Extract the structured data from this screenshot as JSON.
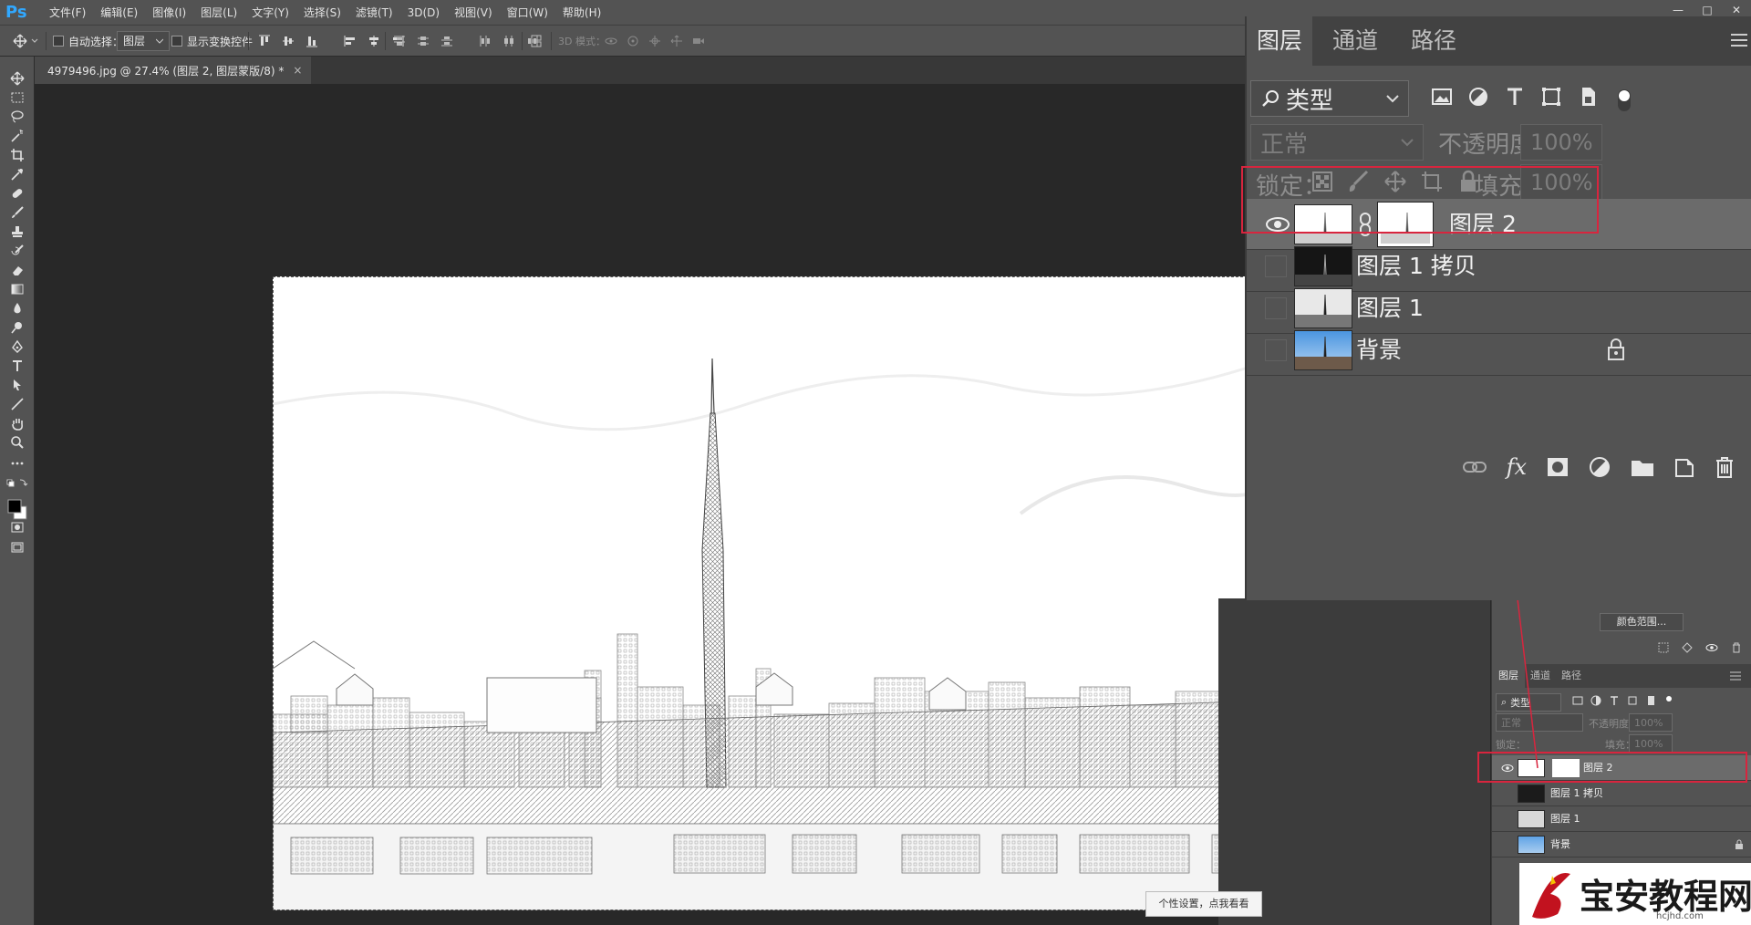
{
  "menu": {
    "logo": "Ps",
    "items": [
      "文件(F)",
      "编辑(E)",
      "图像(I)",
      "图层(L)",
      "文字(Y)",
      "选择(S)",
      "滤镜(T)",
      "3D(D)",
      "视图(V)",
      "窗口(W)",
      "帮助(H)"
    ]
  },
  "window_controls": [
    "—",
    "□",
    "✕"
  ],
  "options_bar": {
    "auto_select_label": "自动选择：",
    "auto_select_value": "图层",
    "show_transform_label": "显示变换控件",
    "mode_3d_label": "3D 模式："
  },
  "document": {
    "tab_title": "4979496.jpg @ 27.4% (图层 2, 图层蒙版/8) *",
    "tab_close": "×"
  },
  "layers_panel": {
    "tabs": [
      "图层",
      "通道",
      "路径"
    ],
    "filter_kind": "类型",
    "blend_mode": "正常",
    "opacity_label": "不透明度：",
    "opacity_value": "100%",
    "lock_label": "锁定：",
    "fill_label": "填充：",
    "fill_value": "100%",
    "layers": [
      {
        "name": "图层 2",
        "visible": true,
        "selected": true,
        "has_mask": true
      },
      {
        "name": "图层 1 拷贝",
        "visible": false,
        "selected": false
      },
      {
        "name": "图层 1",
        "visible": false,
        "selected": false
      },
      {
        "name": "背景",
        "visible": false,
        "selected": false,
        "locked": true
      }
    ],
    "footer_icons": [
      "link-icon",
      "fx-icon",
      "mask-icon",
      "adjustment-icon",
      "folder-icon",
      "new-layer-icon",
      "trash-icon"
    ],
    "fx_label": "fx"
  },
  "small_panel": {
    "color_range_button": "颜色范围...",
    "tabs": [
      "图层",
      "通道",
      "路径"
    ],
    "filter_kind": "类型",
    "blend_mode": "正常",
    "opacity_label": "不透明度：",
    "opacity_value": "100%",
    "lock_label": "锁定：",
    "fill_label": "填充：",
    "fill_value": "100%",
    "layers": [
      {
        "name": "图层 2"
      },
      {
        "name": "图层 1 拷贝"
      },
      {
        "name": "图层 1"
      },
      {
        "name": "背景"
      }
    ]
  },
  "tooltip": "个性设置，点我看看",
  "watermark": {
    "text": "宝安教程网",
    "url": "hcjhd.com"
  },
  "colors": {
    "accent_blue": "#31a8ff",
    "annotation_red": "#d8253e",
    "panel_bg": "#535353",
    "canvas_bg": "#282828"
  }
}
